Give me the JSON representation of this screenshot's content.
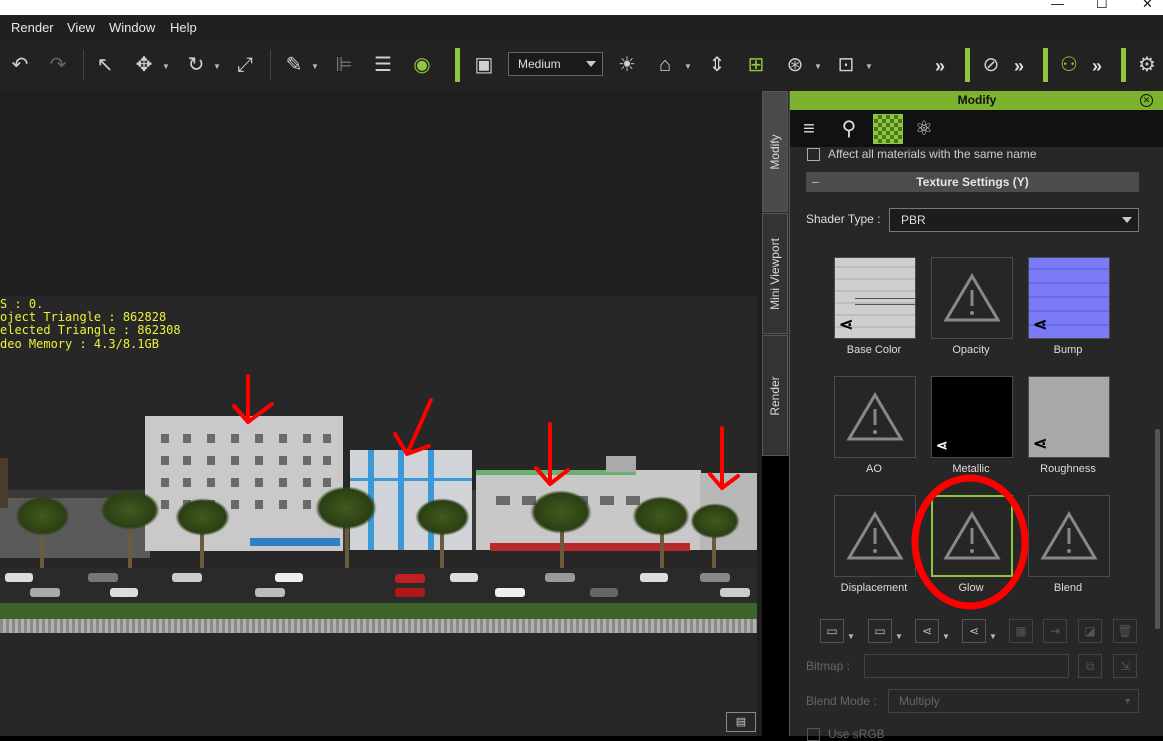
{
  "window": {
    "minimize": "—",
    "maximize": "☐",
    "close": "✕"
  },
  "menu": [
    "Render",
    "View",
    "Window",
    "Help"
  ],
  "toolbar": {
    "quality": "Medium"
  },
  "viewport": {
    "stats": [
      "S : 0.",
      "oject Triangle : 862828",
      "elected Triangle : 862308",
      "deo Memory : 4.3/8.1GB"
    ]
  },
  "side_tabs": [
    "Modify",
    "Mini Viewport",
    "Render"
  ],
  "panel": {
    "title": "Modify",
    "affect_all": "Affect all materials with the same name",
    "section_title": "Texture Settings  (Y)",
    "shader_label": "Shader Type :",
    "shader_value": "PBR",
    "slots": [
      "Base Color",
      "Opacity",
      "Bump",
      "AO",
      "Metallic",
      "Roughness",
      "Displacement",
      "Glow",
      "Blend"
    ],
    "bitmap_label": "Bitmap :",
    "blend_mode_label": "Blend Mode :",
    "blend_mode_value": "Multiply",
    "use_srgb": "Use sRGB"
  },
  "colors": {
    "accent": "#8dc63f",
    "stats_text": "#f0f03c",
    "annotation": "#ff0000"
  }
}
